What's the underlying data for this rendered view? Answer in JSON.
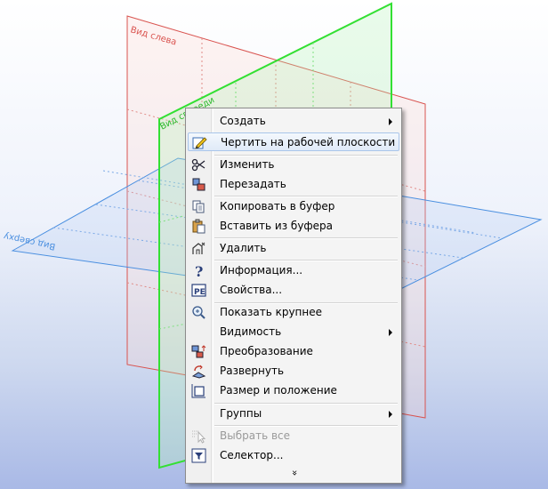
{
  "scene": {
    "left_view_label": "Вид слева",
    "front_view_label": "Вид спереди",
    "top_view_label": "Вид сверху",
    "colors": {
      "left": "#d9534f",
      "front": "#33e033",
      "top": "#4a8fe0"
    }
  },
  "menu": {
    "items": [
      {
        "label": "Создать",
        "icon": "none",
        "submenu": true
      },
      {
        "label": "Чертить на рабочей плоскости",
        "icon": "pencil-icon",
        "highlighted": true
      },
      {
        "label": "Изменить",
        "icon": "scissors-icon"
      },
      {
        "label": "Перезадать",
        "icon": "cubes-icon"
      },
      {
        "label": "Копировать в буфер",
        "icon": "copy-icon"
      },
      {
        "label": "Вставить из буфера",
        "icon": "paste-icon"
      },
      {
        "label": "Удалить",
        "icon": "delete-icon"
      },
      {
        "label": "Информация...",
        "icon": "question-icon"
      },
      {
        "label": "Свойства...",
        "icon": "properties-icon"
      },
      {
        "label": "Показать крупнее",
        "icon": "zoom-icon"
      },
      {
        "label": "Видимость",
        "icon": "none",
        "submenu": true
      },
      {
        "label": "Преобразование",
        "icon": "transform-icon"
      },
      {
        "label": "Развернуть",
        "icon": "unfold-icon"
      },
      {
        "label": "Размер и положение",
        "icon": "size-position-icon"
      },
      {
        "label": "Группы",
        "icon": "none",
        "submenu": true
      },
      {
        "label": "Выбрать все",
        "icon": "select-all-icon",
        "disabled": true
      },
      {
        "label": "Селектор...",
        "icon": "filter-icon"
      }
    ],
    "more_glyph": "»"
  }
}
